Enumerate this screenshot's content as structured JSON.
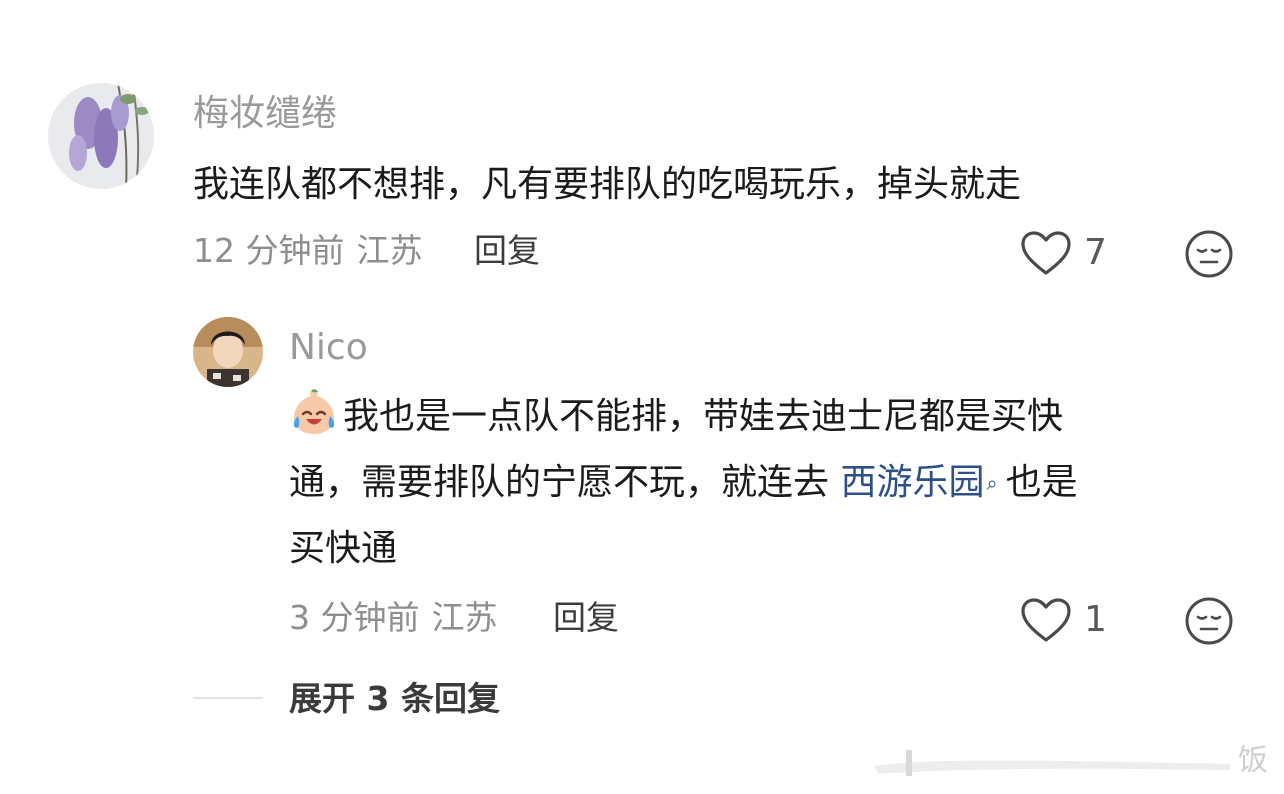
{
  "comments": [
    {
      "username": "梅妆缱绻",
      "text": "我连队都不想排，凡有要排队的吃喝玩乐，掉头就走",
      "time": "12 分钟前",
      "location": "江苏",
      "reply_label": "回复",
      "likes": "7"
    }
  ],
  "reply": {
    "username": "Nico",
    "emoji": "crying-laughing-emoji-icon",
    "line1": "我也是一点队不能排，带娃去迪士尼都是买快",
    "line2_before": "通，需要排队的宁愿不玩，就连去 ",
    "topic_link": "西游乐园",
    "line2_after": "也是",
    "line3": "买快通",
    "time": "3 分钟前",
    "location": "江苏",
    "reply_label": "回复",
    "likes": "1"
  },
  "expand": {
    "label": "展开 3 条回复"
  },
  "watermark": {
    "text": "饭"
  },
  "icons": {
    "like": "heart-outline-icon",
    "dislike": "neutral-face-icon",
    "search": "search-icon"
  },
  "colors": {
    "username": "#9a9a9a",
    "text": "#1b1b1b",
    "link": "#2e4f88",
    "meta": "#8e8e8e"
  }
}
